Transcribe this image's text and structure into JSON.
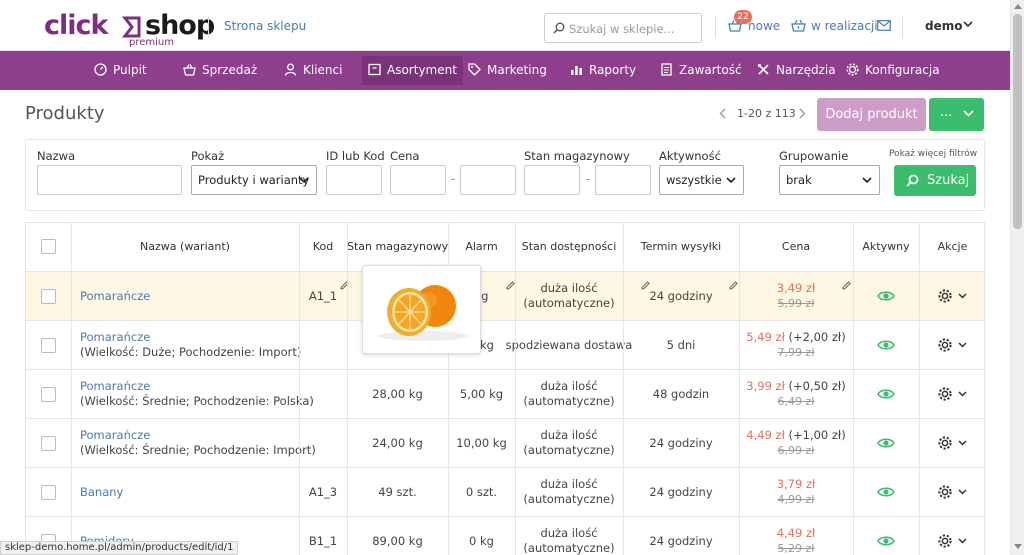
{
  "header": {
    "logo_click": "click",
    "logo_shop": "shop",
    "logo_premium": "premium",
    "store_link": "Strona sklepu",
    "search_placeholder": "Szukaj w sklepie...",
    "new_count": "22",
    "new_label": "nowe",
    "in_progress_label": "w realizacji",
    "user": "demo"
  },
  "nav": [
    {
      "label": "Pulpit",
      "icon": "dashboard-icon"
    },
    {
      "label": "Sprzedaż",
      "icon": "basket-icon"
    },
    {
      "label": "Klienci",
      "icon": "user-icon"
    },
    {
      "label": "Asortyment",
      "icon": "box-icon",
      "active": true
    },
    {
      "label": "Marketing",
      "icon": "tag-icon"
    },
    {
      "label": "Raporty",
      "icon": "bar-chart-icon"
    },
    {
      "label": "Zawartość",
      "icon": "document-icon"
    },
    {
      "label": "Narzędzia",
      "icon": "tools-icon"
    },
    {
      "label": "Konfiguracja",
      "icon": "gear-icon"
    }
  ],
  "page": {
    "title": "Produkty",
    "pager_text": "1-20 z 113",
    "add_button": "Dodaj produkt",
    "more_button": "..."
  },
  "filters": {
    "name_label": "Nazwa",
    "show_label": "Pokaż",
    "show_value": "Produkty i warianty",
    "id_label": "ID lub Kod",
    "price_label": "Cena",
    "stock_label": "Stan magazynowy",
    "activity_label": "Aktywność",
    "activity_value": "wszystkie",
    "group_label": "Grupowanie",
    "group_value": "brak",
    "more_filters": "Pokaż więcej filtrów",
    "search_button": "Szukaj",
    "dash": "-"
  },
  "table": {
    "headers": {
      "name": "Nazwa (wariant)",
      "code": "Kod",
      "stock": "Stan magazynowy",
      "alarm": "Alarm",
      "availability": "Stan dostępności",
      "shipping": "Termin wysyłki",
      "price": "Cena",
      "active": "Aktywny",
      "actions": "Akcje"
    },
    "rows": [
      {
        "name": "Pomarańcze",
        "variant": "",
        "code": "A1_1",
        "stock": "",
        "alarm": "kg",
        "availability": [
          "duża ilość",
          "(automatyczne)"
        ],
        "shipping": "24 godziny",
        "price": "3,49 zł",
        "price_diff": "",
        "old_price": "5,99 zł"
      },
      {
        "name": "Pomarańcze",
        "variant": "(Wielkość: Duże; Pochodzenie: Import)",
        "code": "",
        "stock": "",
        "alarm": "0 kg",
        "availability": [
          "spodziewana dostawa"
        ],
        "shipping": "5 dni",
        "price": "5,49 zł",
        "price_diff": " (+2,00 zł)",
        "old_price": "7,99 zł"
      },
      {
        "name": "Pomarańcze",
        "variant": "(Wielkość: Średnie; Pochodzenie: Polska)",
        "code": "",
        "stock": "28,00 kg",
        "alarm": "5,00 kg",
        "availability": [
          "duża ilość",
          "(automatyczne)"
        ],
        "shipping": "48 godzin",
        "price": "3,99 zł",
        "price_diff": " (+0,50 zł)",
        "old_price": "6,49 zł"
      },
      {
        "name": "Pomarańcze",
        "variant": "(Wielkość: Średnie; Pochodzenie: Import)",
        "code": "",
        "stock": "24,00 kg",
        "alarm": "10,00 kg",
        "availability": [
          "duża ilość",
          "(automatyczne)"
        ],
        "shipping": "24 godziny",
        "price": "4,49 zł",
        "price_diff": " (+1,00 zł)",
        "old_price": "6,99 zł"
      },
      {
        "name": "Banany",
        "variant": "",
        "code": "A1_3",
        "stock": "49 szt.",
        "alarm": "0 szt.",
        "availability": [
          "duża ilość",
          "(automatyczne)"
        ],
        "shipping": "24 godziny",
        "price": "3,79 zł",
        "price_diff": "",
        "old_price": "4,99 zł"
      },
      {
        "name": "Pomidory",
        "variant": "",
        "code": "B1_1",
        "stock": "89,00 kg",
        "alarm": "0 kg",
        "availability": [
          "duża ilość",
          "(automatyczne)"
        ],
        "shipping": "24 godziny",
        "price": "4,49 zł",
        "price_diff": "",
        "old_price": "5,29 zł"
      }
    ]
  },
  "status_url": "sklep-demo.home.pl/admin/products/edit/id/1",
  "colors": {
    "nav_purple": "#8d3f8c",
    "brand_purple": "#7d2f7e",
    "green": "#3cbd6e",
    "price_red": "#e2725b",
    "link_blue": "#4a7bb0",
    "highlight_row": "#fdf7e3"
  }
}
